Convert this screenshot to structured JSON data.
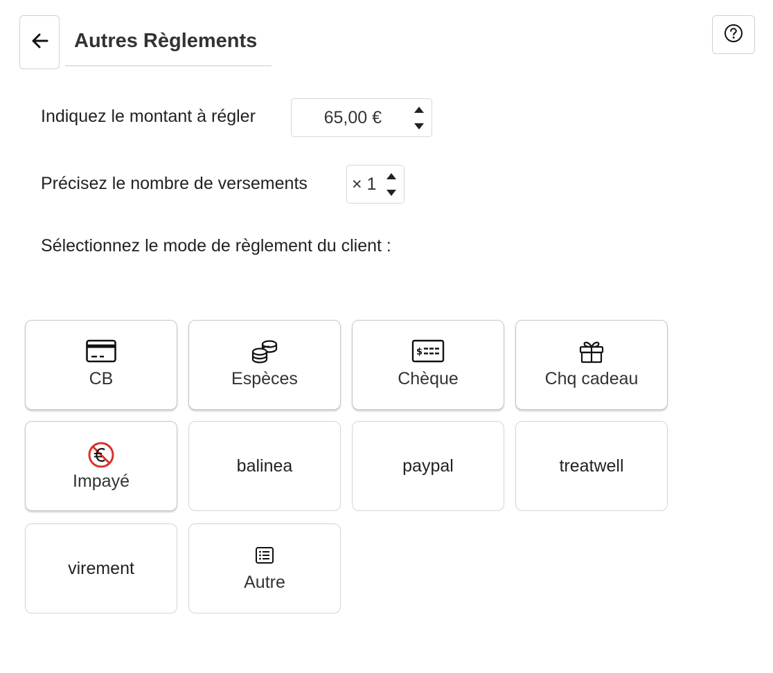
{
  "header": {
    "title": "Autres Règlements",
    "back_icon": "arrow-left-icon",
    "help_icon": "question-circle-icon"
  },
  "amount": {
    "label": "Indiquez le montant à régler",
    "value": "65,00 €"
  },
  "installments": {
    "label": "Précisez le nombre de versements",
    "value": "× 1"
  },
  "payment_modes": {
    "label": "Sélectionnez le mode de règlement du client :",
    "items": [
      {
        "label": "CB",
        "icon": "credit-card-icon"
      },
      {
        "label": "Espèces",
        "icon": "coins-icon"
      },
      {
        "label": "Chèque",
        "icon": "cheque-icon"
      },
      {
        "label": "Chq cadeau",
        "icon": "gift-icon"
      },
      {
        "label": "Impayé",
        "icon": "no-euro-icon"
      },
      {
        "label": "balinea"
      },
      {
        "label": "paypal"
      },
      {
        "label": "treatwell"
      },
      {
        "label": "virement"
      },
      {
        "label": "Autre",
        "icon": "list-icon"
      }
    ]
  },
  "colors": {
    "border": "#d4d4d4",
    "text": "#222222",
    "unpaid_icon": "#d93025"
  }
}
